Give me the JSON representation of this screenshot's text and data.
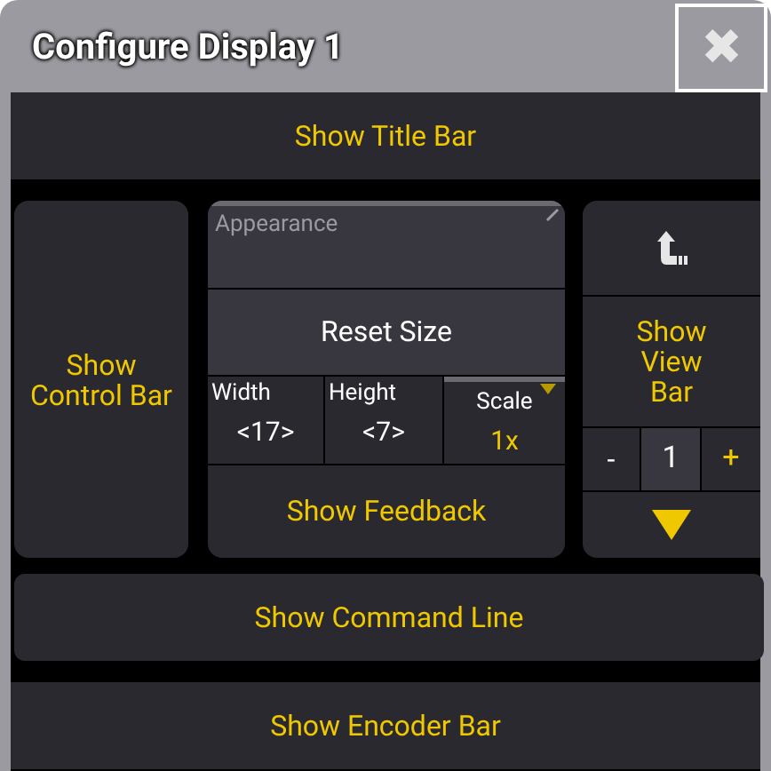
{
  "window": {
    "title": "Configure Display 1",
    "close": "✖"
  },
  "toggles_top": [
    {
      "label": "Show Title Bar",
      "on": true
    }
  ],
  "control_bar": {
    "label": "Show Control Bar",
    "on": true
  },
  "appearance": {
    "header": "Appearance",
    "reset": "Reset Size",
    "width": {
      "label": "Width",
      "value": "<17>"
    },
    "height": {
      "label": "Height",
      "value": "<7>"
    },
    "scale": {
      "label": "Scale",
      "value": "1x"
    },
    "feedback": {
      "label": "Show Feedback",
      "on": true
    }
  },
  "view_bar": {
    "label": "Show View Bar",
    "on": true,
    "minus": "-",
    "value": "1",
    "plus": "+"
  },
  "toggles_bottom": [
    {
      "label": "Show Command Line",
      "on": true
    },
    {
      "label": "Show Encoder Bar",
      "on": true
    }
  ]
}
